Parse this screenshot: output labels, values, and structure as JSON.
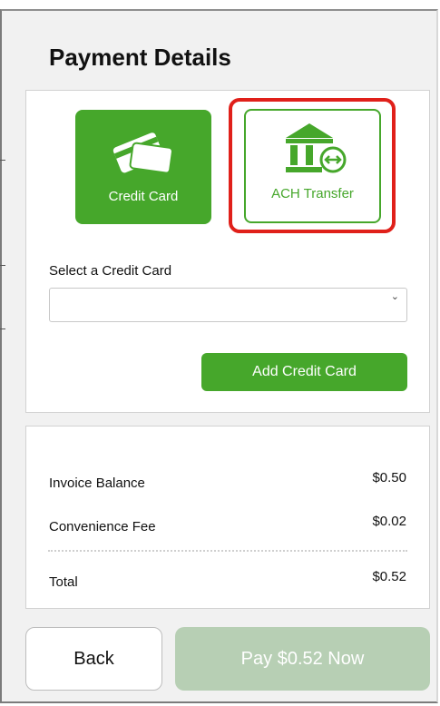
{
  "page_title": "Payment Details",
  "payment_methods": [
    {
      "label": "Credit Card",
      "icon": "credit-cards-icon",
      "selected": true
    },
    {
      "label": "ACH Transfer",
      "icon": "bank-transfer-icon",
      "selected": false
    }
  ],
  "credit_card_select": {
    "label": "Select a Credit Card",
    "value": ""
  },
  "add_card_label": "Add Credit Card",
  "summary": {
    "invoice_balance_label": "Invoice Balance",
    "invoice_balance_value": "$0.50",
    "fee_label": "Convenience Fee",
    "fee_value": "$0.02",
    "total_label": "Total",
    "total_value": "$0.52"
  },
  "footer": {
    "back_label": "Back",
    "pay_label": "Pay $0.52 Now"
  },
  "colors": {
    "accent_green": "#46a72b",
    "pay_disabled": "#b7cfb4",
    "highlight_red": "#e0201a"
  }
}
